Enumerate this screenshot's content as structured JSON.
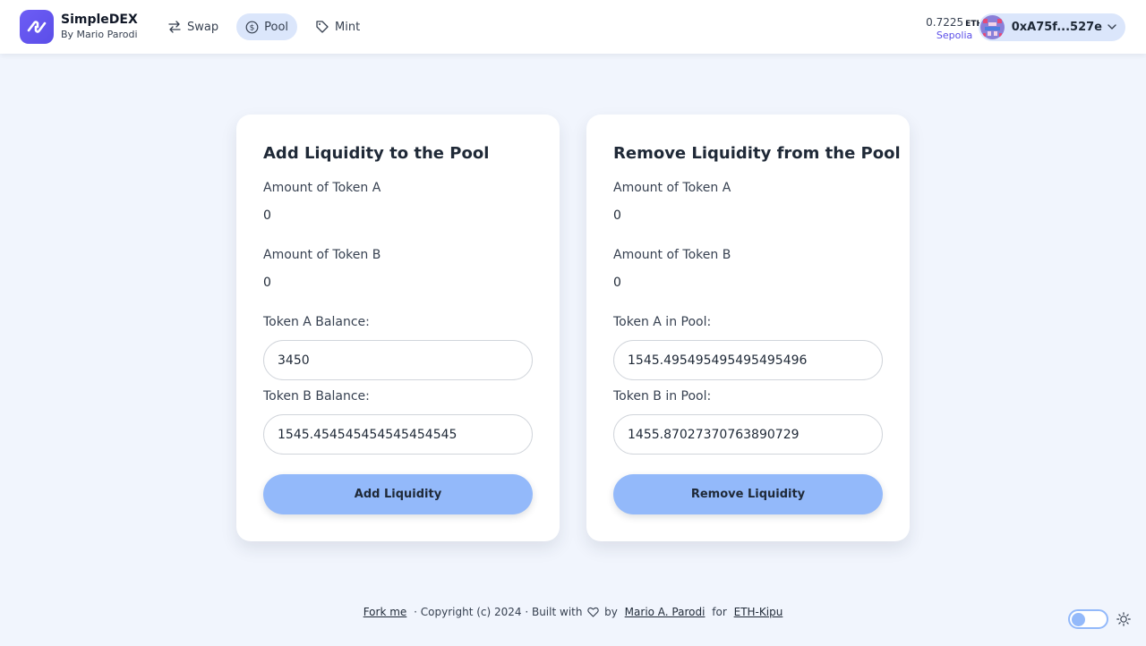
{
  "brand": {
    "title": "SimpleDEX",
    "subtitle": "By Mario Parodi"
  },
  "nav": [
    {
      "label": "Swap",
      "icon": "swap-arrows-icon",
      "active": false
    },
    {
      "label": "Pool",
      "icon": "dollar-coin-icon",
      "active": true
    },
    {
      "label": "Mint",
      "icon": "tag-icon",
      "active": false
    }
  ],
  "wallet": {
    "balance": "0.7225",
    "unit": "ETH",
    "network": "Sepolia",
    "account": "0xA75f...527e"
  },
  "add": {
    "title": "Add Liquidity to the Pool",
    "amount_a_label": "Amount of Token A",
    "amount_a_value": "0",
    "amount_b_label": "Amount of Token B",
    "amount_b_value": "0",
    "balance_a_label": "Token A Balance:",
    "balance_a_value": "3450",
    "balance_b_label": "Token B Balance:",
    "balance_b_value": "1545.454545454545454545",
    "button": "Add Liquidity"
  },
  "remove": {
    "title": "Remove Liquidity from the Pool",
    "amount_a_label": "Amount of Token A",
    "amount_a_value": "0",
    "amount_b_label": "Amount of Token B",
    "amount_b_value": "0",
    "pool_a_label": "Token A in Pool:",
    "pool_a_value": "1545.495495495495495496",
    "pool_b_label": "Token B in Pool:",
    "pool_b_value": "1455.87027370763890729",
    "button": "Remove Liquidity"
  },
  "footer": {
    "fork": "Fork me",
    "sep": "·",
    "copyright": "Copyright (c) 2024 · Built with",
    "by": "by",
    "author": "Mario A. Parodi",
    "for": "for",
    "org": "ETH-Kipu"
  },
  "colors": {
    "accent": "#5b4ee8",
    "button": "#93b9fa",
    "nav_active": "#dbe6fb",
    "background": "#f1f5fd"
  },
  "theme_toggle": {
    "icon": "sun-icon",
    "on": false
  }
}
